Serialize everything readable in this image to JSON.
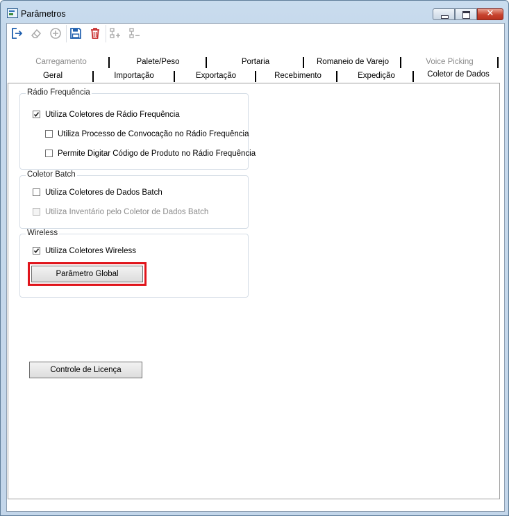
{
  "window": {
    "title": "Parâmetros",
    "close_glyph": "✕"
  },
  "toolbar": {
    "buttons": [
      {
        "name": "exit-icon",
        "enabled": true
      },
      {
        "name": "eraser-icon",
        "enabled": false
      },
      {
        "name": "add-circle-icon",
        "enabled": false
      },
      {
        "name": "save-icon",
        "enabled": true
      },
      {
        "name": "delete-icon",
        "enabled": true
      },
      {
        "name": "add-item-icon",
        "enabled": false
      },
      {
        "name": "remove-item-icon",
        "enabled": false
      }
    ]
  },
  "tabs": {
    "row1": [
      {
        "label": "Carregamento",
        "enabled": false
      },
      {
        "label": "Palete/Peso",
        "enabled": true
      },
      {
        "label": "Portaria",
        "enabled": true
      },
      {
        "label": "Romaneio de Varejo",
        "enabled": true
      },
      {
        "label": "Voice Picking",
        "enabled": false
      }
    ],
    "row2": [
      {
        "label": "Geral",
        "enabled": true
      },
      {
        "label": "Importação",
        "enabled": true
      },
      {
        "label": "Exportação",
        "enabled": true
      },
      {
        "label": "Recebimento",
        "enabled": true
      },
      {
        "label": "Expedição",
        "enabled": true
      },
      {
        "label": "Coletor de Dados",
        "enabled": true,
        "selected": true
      }
    ]
  },
  "groups": {
    "radio": {
      "title": "Rádio Frequência",
      "items": [
        {
          "label": "Utiliza Coletores de Rádio Frequência",
          "checked": true,
          "enabled": true
        },
        {
          "label": "Utiliza Processo de Convocação no Rádio Frequência",
          "checked": false,
          "enabled": true
        },
        {
          "label": "Permite Digitar Código de Produto no Rádio Frequência",
          "checked": false,
          "enabled": true
        }
      ]
    },
    "batch": {
      "title": "Coletor Batch",
      "items": [
        {
          "label": "Utiliza Coletores de Dados Batch",
          "checked": false,
          "enabled": true
        },
        {
          "label": "Utiliza Inventário pelo Coletor de Dados Batch",
          "checked": false,
          "enabled": false
        }
      ]
    },
    "wireless": {
      "title": "Wireless",
      "items": [
        {
          "label": "Utiliza Coletores Wireless",
          "checked": true,
          "enabled": true
        }
      ],
      "button_label": "Parâmetro Global"
    }
  },
  "license_button_label": "Controle de Licença",
  "colors": {
    "highlight": "#e0141b",
    "save_icon": "#1f5fae",
    "delete_icon": "#c62828",
    "exit_icon": "#1f5fae",
    "disabled_icon": "#a8a8a8"
  }
}
